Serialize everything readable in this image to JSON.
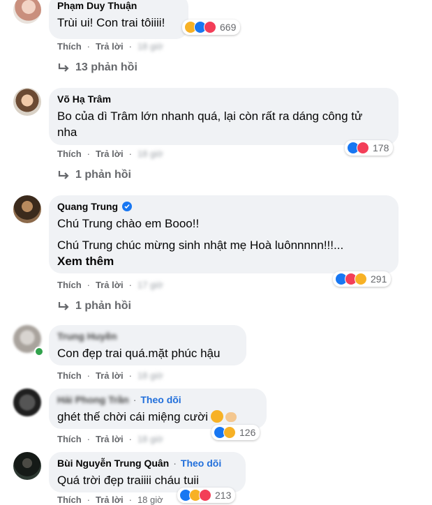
{
  "labels": {
    "like": "Thích",
    "reply": "Trả lời",
    "follow": "Theo dõi",
    "see_more": "Xem thêm"
  },
  "comments": [
    {
      "name": "Phạm Duy Thuận",
      "lines": [
        "Trùi ui! Con trai tôiiii!"
      ],
      "time": "18 giờ",
      "reaction_count": "669",
      "reactions": [
        "haha",
        "like",
        "love"
      ],
      "replies": "13 phản hồi"
    },
    {
      "name": "Võ Hạ Trâm",
      "lines": [
        "Bo của dì Trâm lớn nhanh quá, lại còn rất ra dáng công tử nha"
      ],
      "time": "18 giờ",
      "reaction_count": "178",
      "reactions": [
        "like",
        "love"
      ],
      "replies": "1 phản hồi"
    },
    {
      "name": "Quang Trung",
      "verified": true,
      "lines": [
        "Chú Trung chào em Booo!!",
        "Chú Trung chúc mừng sinh nhật mẹ Hoà luônnnnn!!!..."
      ],
      "time": "17 giờ",
      "reaction_count": "291",
      "reactions": [
        "like",
        "love",
        "haha"
      ],
      "replies": "1 phản hồi"
    },
    {
      "name": "Trung Huyền",
      "lines": [
        "Con đẹp trai quá.mặt phúc hậu"
      ],
      "time": "18 giờ"
    },
    {
      "name": "Hải Phong Trần",
      "follow": true,
      "lines": [
        "ghét thế chời cái miệng cười"
      ],
      "time": "18 giờ",
      "reaction_count": "126",
      "reactions": [
        "like",
        "haha"
      ]
    },
    {
      "name": "Bùi Nguyễn Trung Quân",
      "follow": true,
      "lines": [
        "Quá trời đẹp traiiii cháu tuii"
      ],
      "time": "18 giờ",
      "reaction_count": "213",
      "reactions": [
        "like",
        "haha",
        "love"
      ]
    }
  ],
  "colors": {
    "like": "#1877f2",
    "love": "#f33e58",
    "haha": "#f7b125",
    "bubble": "#f0f2f5",
    "muted": "#65676b"
  }
}
